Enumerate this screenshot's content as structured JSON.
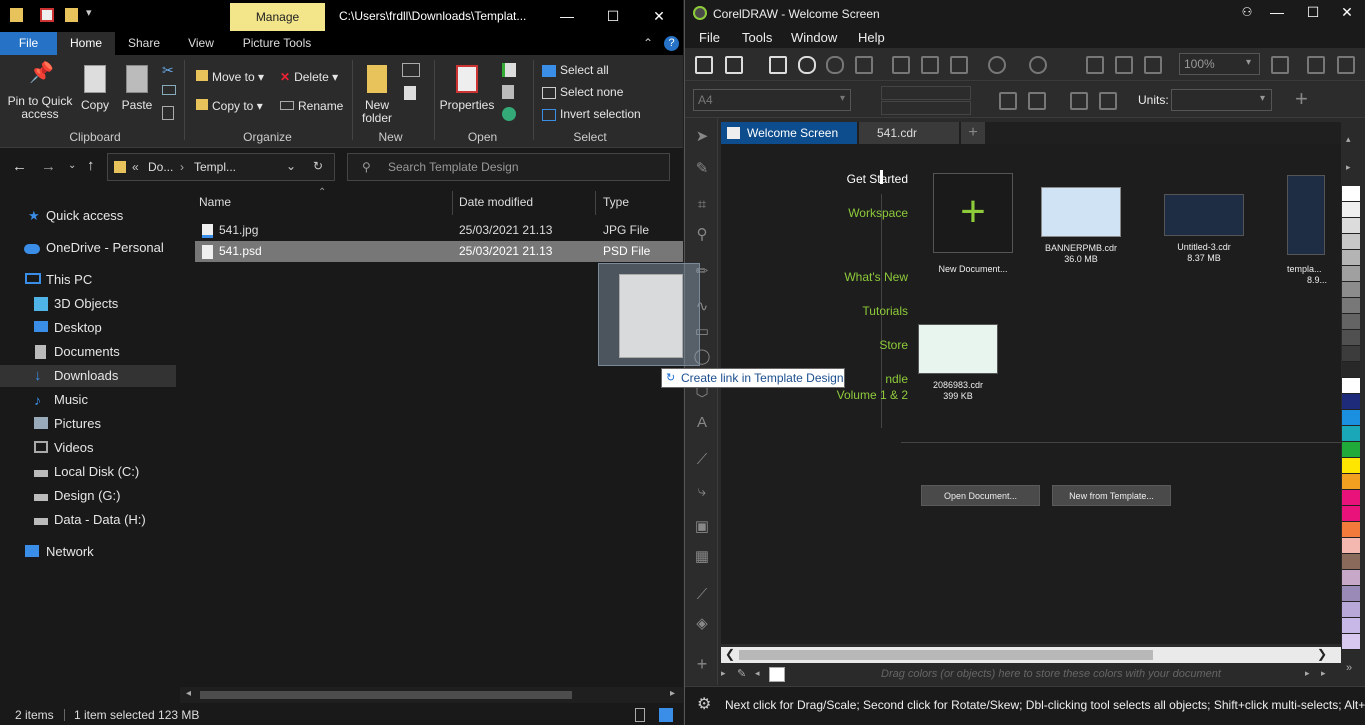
{
  "explorer": {
    "title_path": "C:\\Users\\frdll\\Downloads\\Templat...",
    "contextual_tab": "Manage",
    "tabs": [
      "File",
      "Home",
      "Share",
      "View",
      "Picture Tools"
    ],
    "ribbon": {
      "clipboard": {
        "pin": "Pin to Quick access",
        "copy": "Copy",
        "paste": "Paste",
        "label": "Clipboard"
      },
      "organize": {
        "move_to": "Move to",
        "copy_to": "Copy to",
        "delete": "Delete",
        "rename": "Rename",
        "label": "Organize"
      },
      "new": {
        "new_folder": "New folder",
        "label": "New"
      },
      "open": {
        "properties": "Properties",
        "label": "Open"
      },
      "select": {
        "select_all": "Select all",
        "select_none": "Select none",
        "invert": "Invert selection",
        "label": "Select"
      }
    },
    "address": {
      "crumb1": "Do...",
      "crumb2": "Templ...",
      "prefix": "«"
    },
    "search_placeholder": "Search Template Design",
    "nav": [
      {
        "label": "Quick access",
        "icon": "star-icon",
        "color": "#3b8ee8"
      },
      {
        "label": "OneDrive - Personal",
        "icon": "cloud-icon",
        "color": "#3b8ee8"
      },
      {
        "label": "This PC",
        "icon": "monitor-icon",
        "color": "#3b8ee8"
      },
      {
        "label": "3D Objects",
        "icon": "cube-icon",
        "color": "#4fb3e8"
      },
      {
        "label": "Desktop",
        "icon": "desktop-icon",
        "color": "#3b8ee8"
      },
      {
        "label": "Documents",
        "icon": "document-icon",
        "color": "#bbbbbb"
      },
      {
        "label": "Downloads",
        "icon": "download-arrow-icon",
        "color": "#3b8ee8"
      },
      {
        "label": "Music",
        "icon": "music-note-icon",
        "color": "#3b8ee8"
      },
      {
        "label": "Pictures",
        "icon": "picture-icon",
        "color": "#bbbbbb"
      },
      {
        "label": "Videos",
        "icon": "film-icon",
        "color": "#bbbbbb"
      },
      {
        "label": "Local Disk (C:)",
        "icon": "drive-icon",
        "color": "#bbbbbb"
      },
      {
        "label": "Design (G:)",
        "icon": "drive-icon",
        "color": "#bbbbbb"
      },
      {
        "label": "Data - Data (H:)",
        "icon": "drive-icon",
        "color": "#bbbbbb"
      },
      {
        "label": "Network",
        "icon": "network-icon",
        "color": "#3b8ee8"
      }
    ],
    "columns": {
      "name": "Name",
      "date": "Date modified",
      "type": "Type"
    },
    "files": [
      {
        "name": "541.jpg",
        "date": "25/03/2021 21.13",
        "type": "JPG File"
      },
      {
        "name": "541.psd",
        "date": "25/03/2021 21.13",
        "type": "PSD File"
      }
    ],
    "status": {
      "items": "2 items",
      "selected": "1 item selected  123 MB"
    }
  },
  "drag": {
    "tooltip": "Create link in Template Design"
  },
  "corel": {
    "title": "CorelDRAW - Welcome Screen",
    "menu": [
      "File",
      "Tools",
      "Window",
      "Help"
    ],
    "zoom": "100%",
    "page_size": "A4",
    "units_label": "Units:",
    "doc_tabs": {
      "welcome": "Welcome Screen",
      "file": "541.cdr"
    },
    "welcome_nav": {
      "get_started": "Get Started",
      "workspace": "Workspace",
      "whats_new": "What's New",
      "tutorials": "Tutorials",
      "store": "Store",
      "bundle_partial": "ndle",
      "bundle_line2": "Volume 1 & 2"
    },
    "recent": [
      {
        "name": "New Document...",
        "size": ""
      },
      {
        "name": "BANNERPMB.cdr",
        "size": "36.0 MB"
      },
      {
        "name": "Untitled-3.cdr",
        "size": "8.37 MB"
      },
      {
        "name": "templa...",
        "size": "8.9..."
      },
      {
        "name": "2086983.cdr",
        "size": "399 KB"
      }
    ],
    "buttons": {
      "open": "Open Document...",
      "new_template": "New from Template..."
    },
    "colorstrip_hint": "Drag colors (or objects) here to store these colors with your document",
    "status": "Next click for Drag/Scale; Second click for Rotate/Skew; Dbl-clicking tool selects all objects; Shift+click multi-selects; Alt+",
    "palette": [
      "#ffffff",
      "#f0f0f0",
      "#dcdcdc",
      "#c8c8c8",
      "#b4b4b4",
      "#a0a0a0",
      "#8c8c8c",
      "#787878",
      "#646464",
      "#505050",
      "#3c3c3c",
      "#282828",
      "#ffffff",
      "#1e2a7a",
      "#1b8fe0",
      "#1aa8b8",
      "#1faa3a",
      "#ffe600",
      "#f2a01f",
      "#e8127a",
      "#e8127a",
      "#f27a3a",
      "#f4b8b0",
      "#8a6a5a",
      "#c8a8c8",
      "#9a8ab8",
      "#b8a8d8",
      "#c8b8e8",
      "#d8c8f0"
    ]
  }
}
